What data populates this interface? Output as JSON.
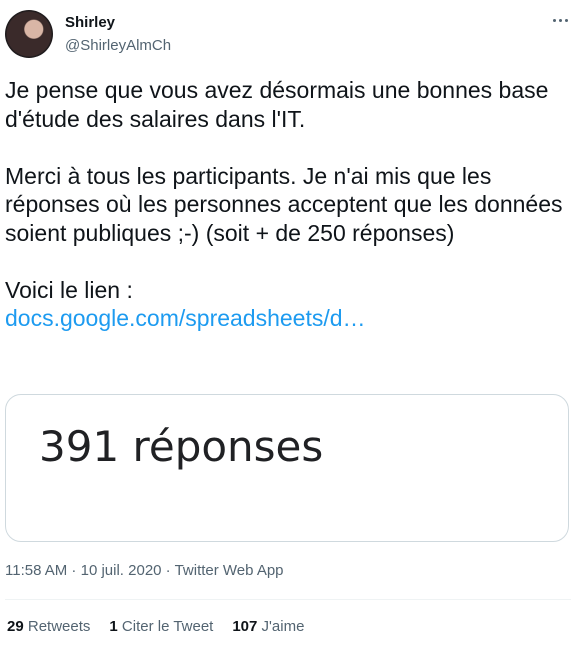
{
  "author": {
    "name": "Shirley",
    "handle": "@ShirleyAlmCh"
  },
  "tweet": {
    "text": "Je pense que vous avez désormais une bonnes base d'étude des salaires dans l'IT.\n\nMerci à tous les participants. Je n'ai mis que les réponses où les personnes acceptent que les données soient publiques ;-) (soit + de 250 réponses)\n\nVoici le lien :",
    "link": "docs.google.com/spreadsheets/d…"
  },
  "card": {
    "text": "391 réponses"
  },
  "meta": {
    "time": "11:58 AM",
    "separator1": " · ",
    "date": "10 juil. 2020",
    "separator2": " · ",
    "source": "Twitter Web App"
  },
  "stats": {
    "retweets_count": "29",
    "retweets_label": "Retweets",
    "quotes_count": "1",
    "quotes_label": "Citer le Tweet",
    "likes_count": "107",
    "likes_label": "J'aime"
  },
  "icons": {
    "more": "more-horizontal-icon"
  }
}
